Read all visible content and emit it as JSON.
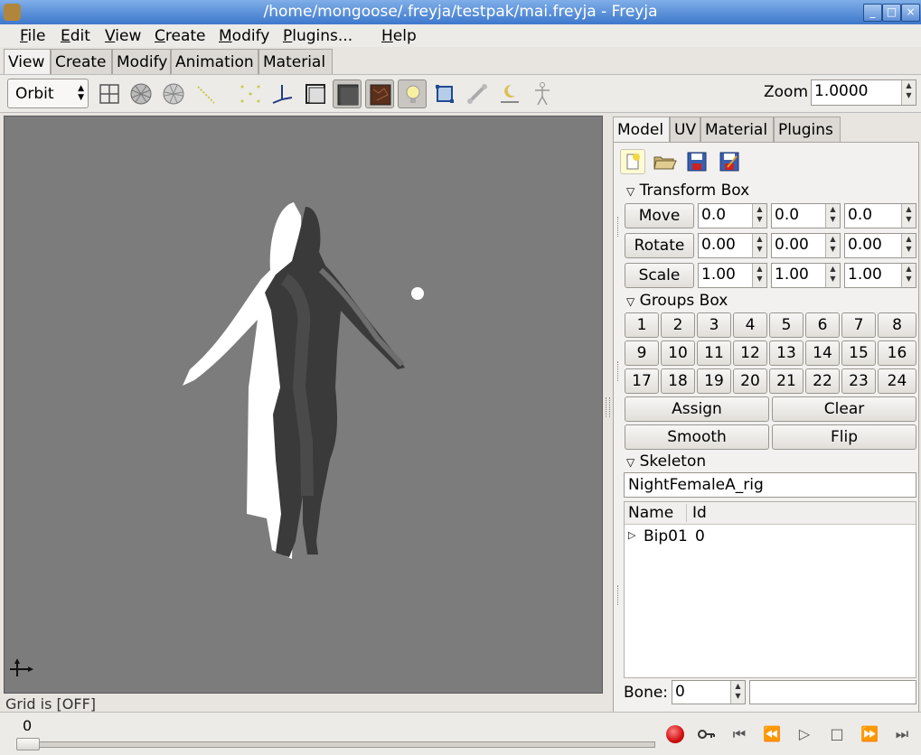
{
  "window": {
    "title": "/home/mongoose/.freyja/testpak/mai.freyja - Freyja",
    "buttons": {
      "min": "_",
      "max": "□",
      "close": "×"
    }
  },
  "menubar": {
    "items": [
      {
        "first": "F",
        "rest": "ile"
      },
      {
        "first": "E",
        "rest": "dit"
      },
      {
        "first": "V",
        "rest": "iew"
      },
      {
        "first": "C",
        "rest": "reate"
      },
      {
        "first": "M",
        "rest": "odify"
      },
      {
        "first": "P",
        "rest": "lugins..."
      },
      {
        "first": "H",
        "rest": "elp"
      }
    ]
  },
  "main_tabs": [
    "View",
    "Create",
    "Modify",
    "Animation",
    "Material"
  ],
  "toolbar": {
    "mode": "Orbit",
    "zoom_label": "Zoom",
    "zoom_value": "1.0000"
  },
  "viewport": {
    "status": "Grid is [OFF]"
  },
  "panel": {
    "tabs": [
      "Model",
      "UV",
      "Material",
      "Plugins"
    ],
    "transform": {
      "title": "Transform Box",
      "move": "Move",
      "rotate": "Rotate",
      "scale": "Scale",
      "move_vals": [
        "0.0",
        "0.0",
        "0.0"
      ],
      "rotate_vals": [
        "0.00",
        "0.00",
        "0.00"
      ],
      "scale_vals": [
        "1.00",
        "1.00",
        "1.00"
      ]
    },
    "groups": {
      "title": "Groups Box",
      "numbers": [
        "1",
        "2",
        "3",
        "4",
        "5",
        "6",
        "7",
        "8",
        "9",
        "10",
        "11",
        "12",
        "13",
        "14",
        "15",
        "16",
        "17",
        "18",
        "19",
        "20",
        "21",
        "22",
        "23",
        "24"
      ],
      "assign": "Assign",
      "clear": "Clear",
      "smooth": "Smooth",
      "flip": "Flip"
    },
    "skeleton": {
      "title": "Skeleton",
      "name": "NightFemaleA_rig",
      "col_name": "Name",
      "col_id": "Id",
      "rows": [
        {
          "name": "Bip01",
          "id": "0"
        }
      ],
      "bone_label": "Bone:",
      "bone_value": "0"
    }
  },
  "timeline": {
    "frame": "0"
  }
}
